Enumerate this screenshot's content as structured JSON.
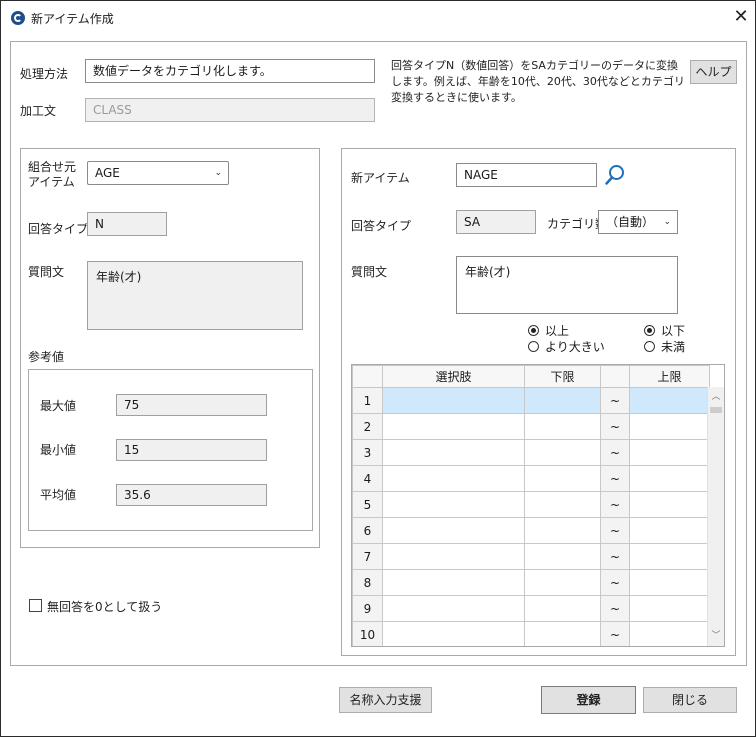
{
  "window": {
    "title": "新アイテム作成",
    "close_glyph": "✕"
  },
  "top": {
    "processing_label": "処理方法",
    "processing_value": "数値データをカテゴリ化します。",
    "processed_label": "加工文",
    "processed_value": "CLASS",
    "description": "回答タイプN（数値回答）をSAカテゴリーのデータに変換します。例えば、年齢を10代、20代、30代などとカテゴリ変換するときに使います。",
    "help_label": "ヘルプ"
  },
  "left": {
    "source_item_label": "組合せ元\nアイテム",
    "source_item_value": "AGE",
    "answer_type_label": "回答タイプ",
    "answer_type_value": "N",
    "question_label": "質問文",
    "question_value": "年齢(才)",
    "reference_label": "参考値",
    "max_label": "最大値",
    "max_value": "75",
    "min_label": "最小値",
    "min_value": "15",
    "avg_label": "平均値",
    "avg_value": "35.6",
    "no_answer_label": "無回答を0として扱う"
  },
  "right": {
    "new_item_label": "新アイテム",
    "new_item_value": "NAGE",
    "answer_type_label": "回答タイプ",
    "answer_type_value": "SA",
    "category_count_label": "カテゴリ数",
    "category_count_value": "（自動）",
    "question_label": "質問文",
    "question_value": "年齢(才)",
    "lower_options": [
      "以上",
      "より大きい"
    ],
    "lower_selected": 0,
    "upper_options": [
      "以下",
      "未満"
    ],
    "upper_selected": 0
  },
  "grid": {
    "columns": [
      "",
      "選択肢",
      "下限",
      "",
      "上限"
    ],
    "rows": [
      {
        "no": "1",
        "choice": "",
        "lower": "",
        "tilde": "~",
        "upper": ""
      },
      {
        "no": "2",
        "choice": "",
        "lower": "",
        "tilde": "~",
        "upper": ""
      },
      {
        "no": "3",
        "choice": "",
        "lower": "",
        "tilde": "~",
        "upper": ""
      },
      {
        "no": "4",
        "choice": "",
        "lower": "",
        "tilde": "~",
        "upper": ""
      },
      {
        "no": "5",
        "choice": "",
        "lower": "",
        "tilde": "~",
        "upper": ""
      },
      {
        "no": "6",
        "choice": "",
        "lower": "",
        "tilde": "~",
        "upper": ""
      },
      {
        "no": "7",
        "choice": "",
        "lower": "",
        "tilde": "~",
        "upper": ""
      },
      {
        "no": "8",
        "choice": "",
        "lower": "",
        "tilde": "~",
        "upper": ""
      },
      {
        "no": "9",
        "choice": "",
        "lower": "",
        "tilde": "~",
        "upper": ""
      },
      {
        "no": "10",
        "choice": "",
        "lower": "",
        "tilde": "~",
        "upper": ""
      }
    ]
  },
  "footer": {
    "name_assist_label": "名称入力支援",
    "register_label": "登録",
    "close_label": "閉じる"
  },
  "colors": {
    "selected_cell": "#cfe8fb",
    "icon_blue": "#1f6fb8"
  }
}
